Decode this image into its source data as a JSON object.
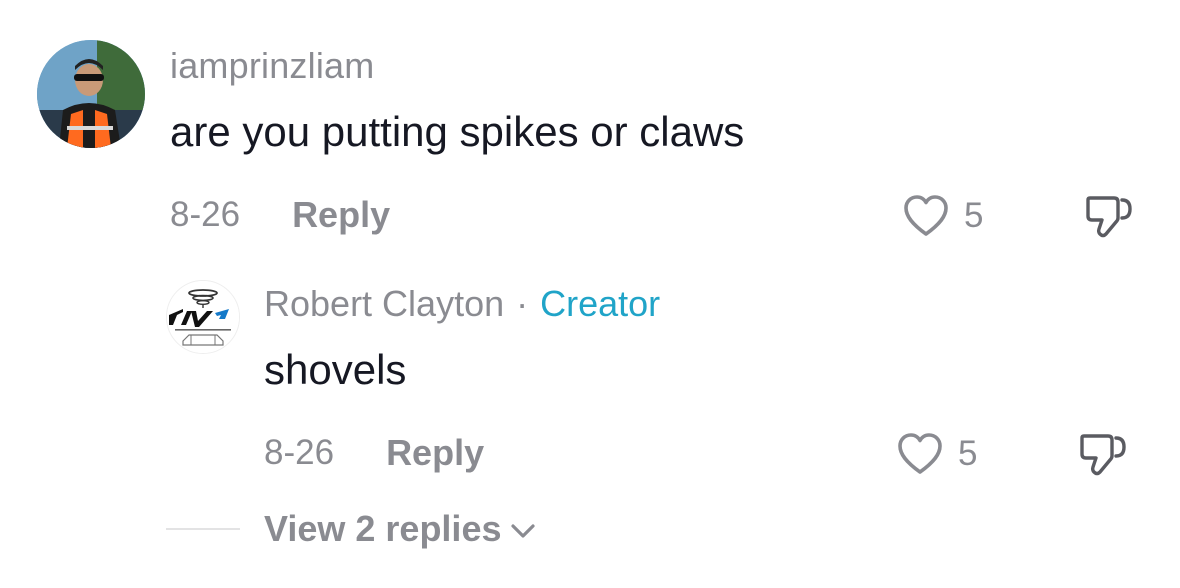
{
  "comment": {
    "username": "iamprinzliam",
    "text": "are you putting spikes or claws",
    "date": "8-26",
    "reply_label": "Reply",
    "like_count": "5",
    "icons": {
      "like": "heart-outline-icon",
      "dislike": "thumbs-down-outline-icon"
    }
  },
  "reply": {
    "author": "Robert Clayton",
    "separator": "·",
    "badge": "Creator",
    "text": "shovels",
    "date": "8-26",
    "reply_label": "Reply",
    "like_count": "5"
  },
  "view_replies": {
    "label": "View 2 replies",
    "icon": "chevron-down-icon"
  },
  "colors": {
    "secondary_text": "#8a8b91",
    "primary_text": "#161823",
    "creator_badge": "#20a4c8",
    "divider": "#e3e3e4"
  }
}
